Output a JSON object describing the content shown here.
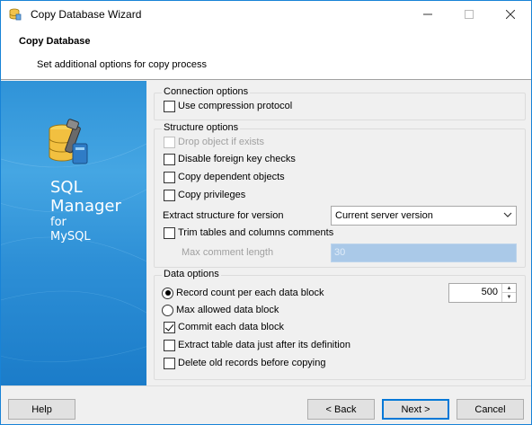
{
  "window": {
    "title": "Copy Database Wizard",
    "minimize": "—",
    "maximize": "☐",
    "close": "✕"
  },
  "header": {
    "title": "Copy Database",
    "subtitle": "Set additional options for copy process"
  },
  "banner": {
    "line1": "SQL",
    "line2": "Manager",
    "line3": "for",
    "line4": "MySQL",
    "logo_icon": "database-tools-icon"
  },
  "connection": {
    "group_title": "Connection options",
    "use_compression": {
      "label": "Use compression protocol",
      "checked": false
    }
  },
  "structure": {
    "group_title": "Structure options",
    "drop_object": {
      "label": "Drop object if exists",
      "checked": false,
      "enabled": false
    },
    "disable_fk": {
      "label": "Disable foreign key checks",
      "checked": false
    },
    "copy_dependent": {
      "label": "Copy dependent objects",
      "checked": false
    },
    "copy_privileges": {
      "label": "Copy privileges",
      "checked": false
    },
    "extract_label": "Extract structure for version",
    "extract_value": "Current server version",
    "trim_comments": {
      "label": "Trim tables and columns comments",
      "checked": false
    },
    "max_comment_label": "Max comment length",
    "max_comment_value": "30"
  },
  "data_opts": {
    "group_title": "Data options",
    "record_count": {
      "label": "Record count per each data block",
      "selected": true
    },
    "record_count_value": "500",
    "max_allowed": {
      "label": "Max allowed data block",
      "selected": false
    },
    "commit_each": {
      "label": "Commit each data block",
      "checked": true
    },
    "extract_after": {
      "label": "Extract table data just after its definition",
      "checked": false
    },
    "delete_old": {
      "label": "Delete old records before copying",
      "checked": false
    }
  },
  "footer": {
    "help": "Help",
    "back": "< Back",
    "next": "Next >",
    "cancel": "Cancel"
  },
  "colors": {
    "accent": "#0078d7",
    "banner": "#2d8fd6"
  }
}
